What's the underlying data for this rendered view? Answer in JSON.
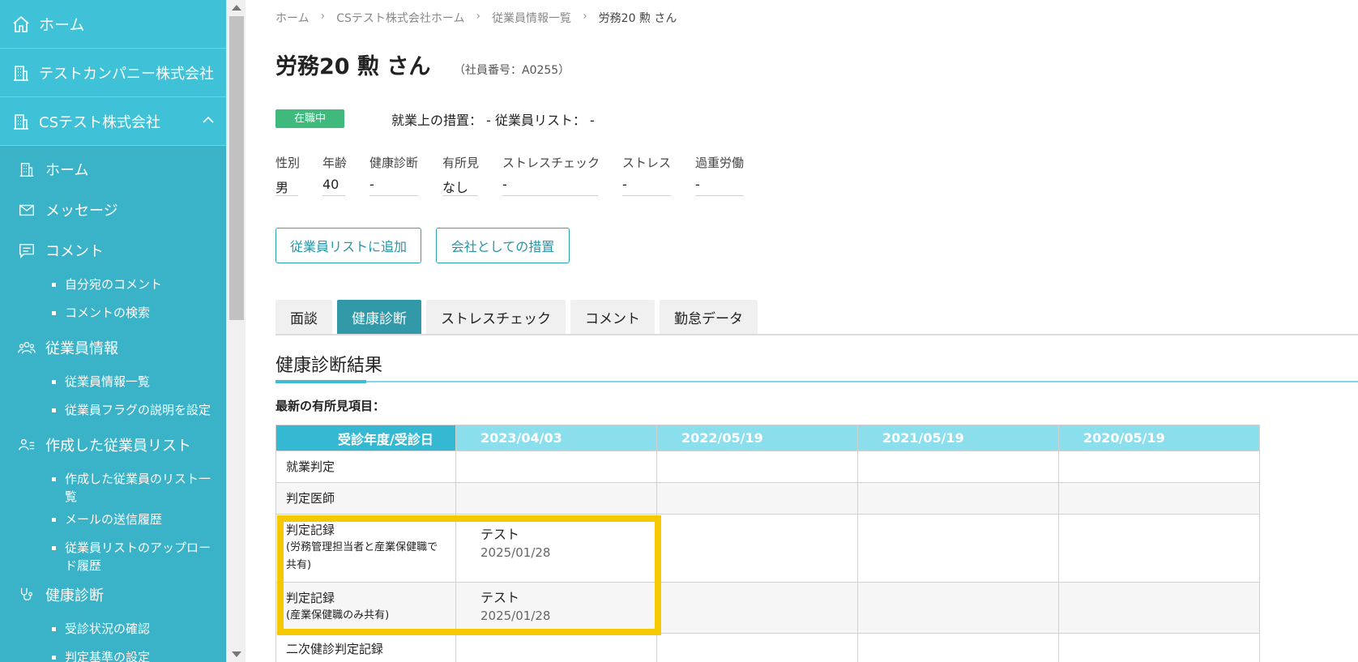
{
  "sidebar": {
    "top_items": [
      {
        "label": "ホーム",
        "icon": "house-icon"
      },
      {
        "label": "テストカンパニー株式会社",
        "icon": "building-icon"
      },
      {
        "label": "CSテスト株式会社",
        "icon": "building-icon"
      }
    ],
    "items": [
      {
        "label": "ホーム",
        "icon": "building-icon"
      },
      {
        "label": "メッセージ",
        "icon": "envelope-icon"
      },
      {
        "label": "コメント",
        "icon": "comment-icon"
      }
    ],
    "comment_sub": [
      "自分宛のコメント",
      "コメントの検索"
    ],
    "employee_info": "従業員情報",
    "employee_sub": [
      "従業員情報一覧",
      "従業員フラグの説明を設定"
    ],
    "employee_list": "作成した従業員リスト",
    "employee_list_sub": [
      "作成した従業員のリスト一覧",
      "メールの送信履歴",
      "従業員リストのアップロード履歴"
    ],
    "health": "健康診断",
    "health_sub": [
      "受診状況の確認",
      "判定基準の設定"
    ]
  },
  "breadcrumb": [
    "ホーム",
    "CSテスト株式会社ホーム",
    "従業員情報一覧",
    "労務20 勲 さん"
  ],
  "employee": {
    "name": "労務20 勲 さん",
    "number": "（社員番号：A0255）",
    "status": "在職中",
    "measures": "就業上の措置：  -    従業員リスト：  -"
  },
  "profile": [
    {
      "label": "性別",
      "value": "男"
    },
    {
      "label": "年齢",
      "value": "40"
    },
    {
      "label": "健康診断",
      "value": "-"
    },
    {
      "label": "有所見",
      "value": "なし"
    },
    {
      "label": "ストレスチェック",
      "value": "-"
    },
    {
      "label": "ストレス",
      "value": "-"
    },
    {
      "label": "過重労働",
      "value": "-"
    }
  ],
  "buttons": {
    "add_list": "従業員リストに追加",
    "company_measure": "会社としての措置"
  },
  "tabs": [
    "面談",
    "健康診断",
    "ストレスチェック",
    "コメント",
    "勤怠データ"
  ],
  "section": {
    "title": "健康診断結果",
    "latest": "最新の有所見項目："
  },
  "table": {
    "header": "受診年度/受診日",
    "dates": [
      "2023/04/03",
      "2022/05/19",
      "2021/05/19",
      "2020/05/19"
    ],
    "rows": {
      "r1": "就業判定",
      "r2": "判定医師",
      "r3_title": "判定記録",
      "r3_sub": "(労務管理担当者と産業保健職で共有)",
      "r3_value": "テスト",
      "r3_date": "2025/01/28",
      "r4_title": "判定記録",
      "r4_sub": "(産業保健職のみ共有)",
      "r4_value": "テスト",
      "r4_date": "2025/01/28",
      "r5": "二次健診判定記録"
    }
  },
  "colors": {
    "sidebar": "#3cbdd4",
    "accent": "#3199a8",
    "status": "#3fb97c",
    "highlight": "#f6c800"
  }
}
